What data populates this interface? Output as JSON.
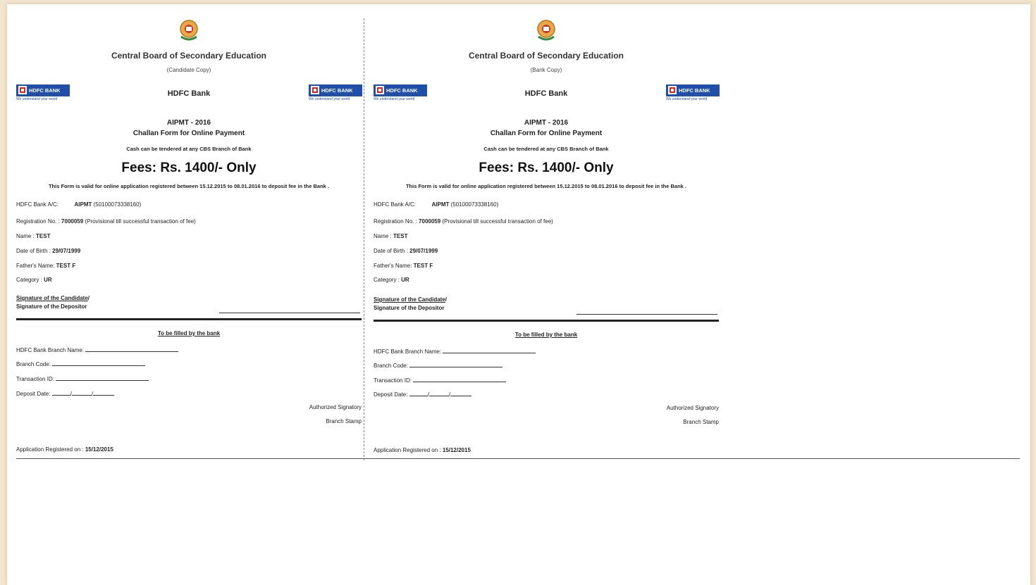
{
  "copies": [
    {
      "board": "Central Board of Secondary Education",
      "copy_type": "(Candidate Copy)",
      "bank_title": "HDFC Bank",
      "logo_text": "HDFC BANK",
      "logo_tagline": "We understand your world",
      "exam": "AIPMT - 2016",
      "form_title": "Challan Form for Online Payment",
      "cash_note": "Cash can be tendered at any CBS Branch of Bank",
      "fees": "Fees: Rs.  1400/- Only",
      "validity": "This Form is valid for online application registered between 15.12.2015 to 08.01.2016 to deposit fee in the Bank .",
      "account_label": "HDFC Bank A/C:",
      "account_value": "AIPMT",
      "account_number": "(50100073338160)",
      "reg_label": "Registration No. :",
      "reg_value": "7000059",
      "reg_note": "(Provisional till successful transaction of fee)",
      "name_label": "Name :",
      "name_value": "TEST",
      "dob_label": "Date of Birth :",
      "dob_value": "29/07/1999",
      "father_label": "Father's Name:",
      "father_value": "TEST F",
      "category_label": "Category :",
      "category_value": "UR",
      "sig_candidate": "Signature of the Candidate",
      "sig_depositor": "Signature of the Depositor",
      "bank_section": "To be filled by the bank",
      "branch_name_label": "HDFC Bank Branch Name:",
      "branch_code_label": "Branch Code:",
      "transaction_label": "Transaction ID:",
      "deposit_label": "Deposit Date:",
      "authorized": "Authorized Signatory",
      "stamp": "Branch Stamp",
      "registered_label": "Application Registered on :",
      "registered_value": "15/12/2015"
    },
    {
      "board": "Central Board of Secondary Education",
      "copy_type": "(Bank Copy)",
      "bank_title": "HDFC Bank",
      "logo_text": "HDFC BANK",
      "logo_tagline": "We understand your world",
      "exam": "AIPMT - 2016",
      "form_title": "Challan Form for Online Payment",
      "cash_note": "Cash can be tendered at any CBS Branch of Bank",
      "fees": "Fees: Rs.  1400/- Only",
      "validity": "This Form is valid for online application registered between 15.12.2015 to 08.01.2016 to deposit fee in the Bank .",
      "account_label": "HDFC Bank A/C:",
      "account_value": "AIPMT",
      "account_number": "(50100073338160)",
      "reg_label": "Registration No. :",
      "reg_value": "7000059",
      "reg_note": "(Provisional till successful transaction of fee)",
      "name_label": "Name :",
      "name_value": "TEST",
      "dob_label": "Date of Birth :",
      "dob_value": "29/07/1999",
      "father_label": "Father's Name:",
      "father_value": "TEST F",
      "category_label": "Category :",
      "category_value": "UR",
      "sig_candidate": "Signature of the Candidate",
      "sig_depositor": "Signature of the Depositor",
      "bank_section": "To be filled by the bank",
      "branch_name_label": "HDFC Bank Branch Name:",
      "branch_code_label": "Branch Code:",
      "transaction_label": "Transaction ID:",
      "deposit_label": "Deposit Date:",
      "authorized": "Authorized Signatory",
      "stamp": "Branch Stamp",
      "registered_label": "Application Registered on :",
      "registered_value": "15/12/2015"
    }
  ]
}
